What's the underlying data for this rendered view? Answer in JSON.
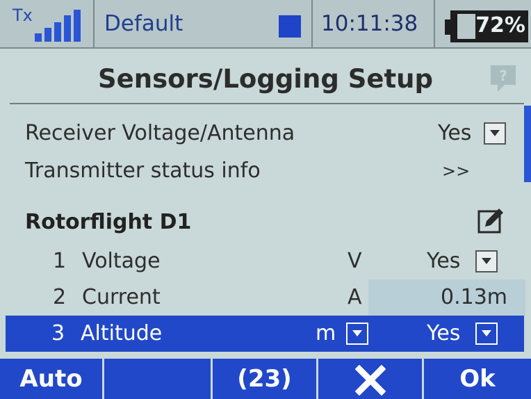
{
  "status_bar": {
    "tx_label": "Tx",
    "model_name": "Default",
    "time": "10:11:38",
    "battery_percent": "72%",
    "battery_level": 0.72
  },
  "title": "Sensors/Logging Setup",
  "rows": {
    "receiver_voltage": {
      "label": "Receiver Voltage/Antenna",
      "value": "Yes"
    },
    "transmitter_status": {
      "label": "Transmitter status info",
      "value": ">>"
    }
  },
  "section": {
    "label": "Rotorflight D1"
  },
  "sensors": [
    {
      "num": "1",
      "name": "Voltage",
      "unit": "V",
      "value": "Yes"
    },
    {
      "num": "2",
      "name": "Current",
      "unit": "A",
      "value": "0.13m"
    },
    {
      "num": "3",
      "name": "Altitude",
      "unit": "m",
      "value": "Yes"
    }
  ],
  "softkeys": {
    "auto": "Auto",
    "blank": "",
    "count": "(23)",
    "delete_icon": "x-icon",
    "ok": "Ok"
  },
  "colors": {
    "accent": "#2148c8",
    "background": "#c9d8d8"
  }
}
